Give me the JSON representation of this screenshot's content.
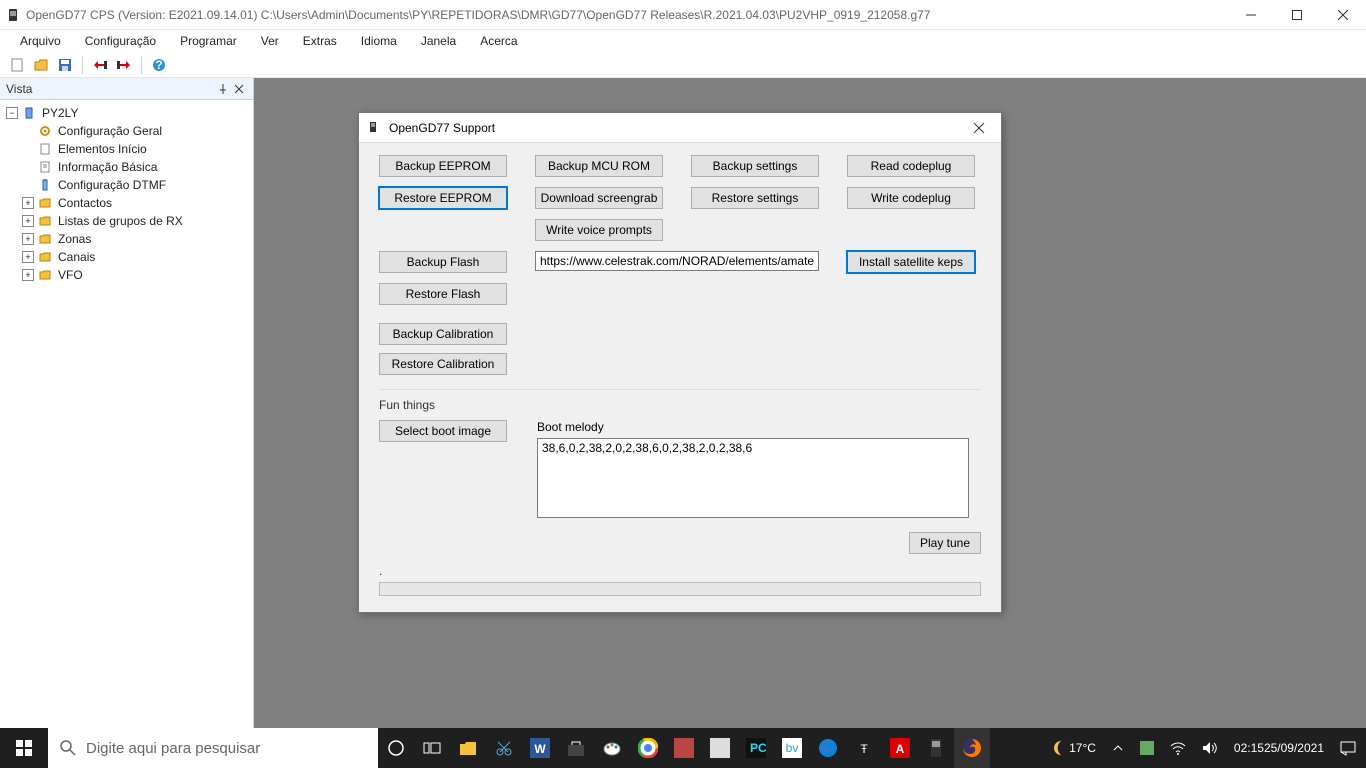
{
  "titlebar": {
    "title": "OpenGD77 CPS (Version: E2021.09.14.01) C:\\Users\\Admin\\Documents\\PY\\REPETIDORAS\\DMR\\GD77\\OpenGD77 Releases\\R.2021.04.03\\PU2VHP_0919_212058.g77"
  },
  "menubar": {
    "items": [
      "Arquivo",
      "Configuração",
      "Programar",
      "Ver",
      "Extras",
      "Idioma",
      "Janela",
      "Acerca"
    ]
  },
  "sidebar": {
    "title": "Vista",
    "root": "PY2LY",
    "nodes": [
      {
        "label": "Configuração Geral",
        "expandable": false,
        "icon": "gear"
      },
      {
        "label": "Elementos Início",
        "expandable": false,
        "icon": "doc"
      },
      {
        "label": "Informação Básica",
        "expandable": false,
        "icon": "info"
      },
      {
        "label": "Configuração DTMF",
        "expandable": false,
        "icon": "dial"
      },
      {
        "label": "Contactos",
        "expandable": true,
        "icon": "folder"
      },
      {
        "label": "Listas de grupos de RX",
        "expandable": true,
        "icon": "folder"
      },
      {
        "label": "Zonas",
        "expandable": true,
        "icon": "folder"
      },
      {
        "label": "Canais",
        "expandable": true,
        "icon": "folder"
      },
      {
        "label": "VFO",
        "expandable": true,
        "icon": "folder"
      }
    ]
  },
  "dialog": {
    "title": "OpenGD77 Support",
    "col1": [
      "Backup EEPROM",
      "Restore EEPROM"
    ],
    "col1b": [
      "Backup Flash",
      "Restore Flash"
    ],
    "col1c": [
      "Backup Calibration",
      "Restore Calibration"
    ],
    "col2": [
      "Backup MCU ROM",
      "Download screengrab",
      "Write voice prompts"
    ],
    "col3": [
      "Backup settings",
      "Restore settings"
    ],
    "col4": [
      "Read codeplug",
      "Write codeplug"
    ],
    "url": "https://www.celestrak.com/NORAD/elements/amateur.txt",
    "install_keps": "Install satellite keps",
    "fun_label": "Fun things",
    "select_boot": "Select boot image",
    "melody_label": "Boot melody",
    "melody": "38,6,0,2,38,2,0,2,38,6,0,2,38,2,0,2,38,6",
    "play": "Play tune",
    "status": "."
  },
  "taskbar": {
    "search_placeholder": "Digite aqui para pesquisar",
    "temp": "17°C",
    "time": "02:15",
    "date": "25/09/2021"
  }
}
